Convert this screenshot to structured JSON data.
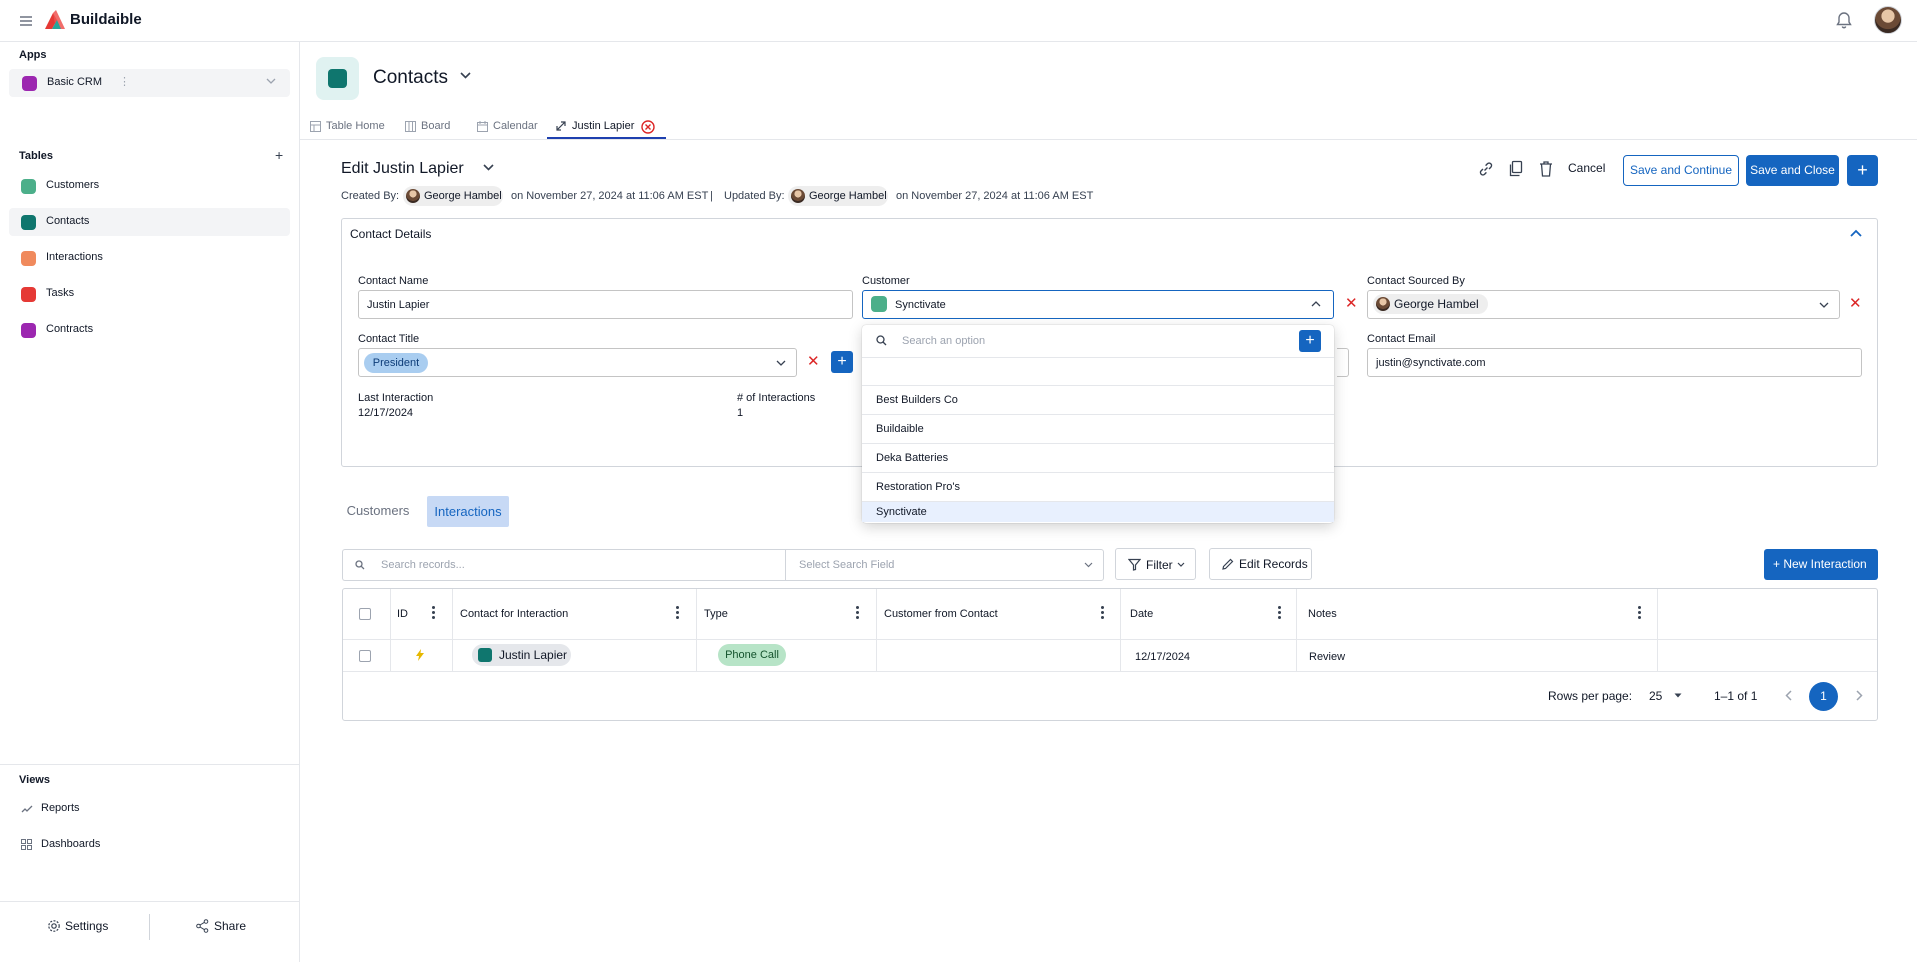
{
  "app": {
    "brand": "Buildaible"
  },
  "sidebar": {
    "apps_heading": "Apps",
    "app_selected": "Basic CRM",
    "tables_heading": "Tables",
    "tables": [
      {
        "label": "Customers",
        "color": "#4caf8a"
      },
      {
        "label": "Contacts",
        "color": "#0f766e"
      },
      {
        "label": "Interactions",
        "color": "#f08a5d"
      },
      {
        "label": "Tasks",
        "color": "#e53935"
      },
      {
        "label": "Contracts",
        "color": "#9c27b0"
      }
    ],
    "views_heading": "Views",
    "views": [
      {
        "label": "Reports",
        "icon": "trend-line-icon"
      },
      {
        "label": "Dashboards",
        "icon": "grid-icon"
      }
    ],
    "footer": {
      "settings": "Settings",
      "share": "Share"
    }
  },
  "header": {
    "title": "Contacts",
    "tabs": [
      {
        "label": "Table Home",
        "icon": "table-icon"
      },
      {
        "label": "Board",
        "icon": "board-icon"
      },
      {
        "label": "Calendar",
        "icon": "calendar-icon"
      },
      {
        "label": "Justin Lapier",
        "icon": "expand-icon",
        "active": true
      }
    ]
  },
  "edit": {
    "title": "Edit Justin Lapier",
    "created_by_label": "Created By:",
    "created_by": "George Hambel",
    "created_on": "on November 27, 2024 at 11:06 AM EST",
    "separator": "|",
    "updated_by_label": "Updated By:",
    "updated_by": "George Hambel",
    "updated_on": "on November 27, 2024 at 11:06 AM EST",
    "actions": {
      "cancel": "Cancel",
      "save_continue": "Save and Continue",
      "save_close": "Save and Close",
      "add": "+"
    }
  },
  "details": {
    "section_title": "Contact Details",
    "contact_name": {
      "label": "Contact Name",
      "value": "Justin Lapier"
    },
    "customer": {
      "label": "Customer",
      "value": "Synctivate"
    },
    "sourced_by": {
      "label": "Contact Sourced By",
      "value": "George Hambel"
    },
    "contact_title": {
      "label": "Contact Title",
      "value": "President"
    },
    "contact_email": {
      "label": "Contact Email",
      "value": "justin@synctivate.com"
    },
    "last_interaction": {
      "label": "Last Interaction",
      "value": "12/17/2024"
    },
    "num_interactions": {
      "label": "# of Interactions",
      "value": "1"
    }
  },
  "dropdown": {
    "placeholder": "Search an option",
    "options": [
      "Best Builders Co",
      "Buildaible",
      "Deka Batteries",
      "Restoration Pro's",
      "Synctivate"
    ],
    "selected": "Synctivate"
  },
  "subtabs": [
    "Customers",
    "Interactions"
  ],
  "toolbar": {
    "search_placeholder": "Search records...",
    "field_placeholder": "Select Search Field",
    "filter": "Filter",
    "edit_records": "Edit Records",
    "new_interaction": "+ New Interaction"
  },
  "grid": {
    "columns": [
      "ID",
      "Contact for Interaction",
      "Type",
      "Customer from Contact",
      "Date",
      "Notes"
    ],
    "rows": [
      {
        "id_icon": "bolt-icon",
        "contact": "Justin Lapier",
        "type": "Phone Call",
        "customer": "",
        "date": "12/17/2024",
        "notes": "Review"
      }
    ],
    "rows_per_page_label": "Rows per page:",
    "rows_per_page": "25",
    "range": "1–1 of 1",
    "page": "1"
  },
  "colors": {
    "primary": "#1565c0",
    "danger": "#dc2626",
    "chip_green": "#b7e4c7",
    "chip_blue": "#a9cdf0"
  }
}
